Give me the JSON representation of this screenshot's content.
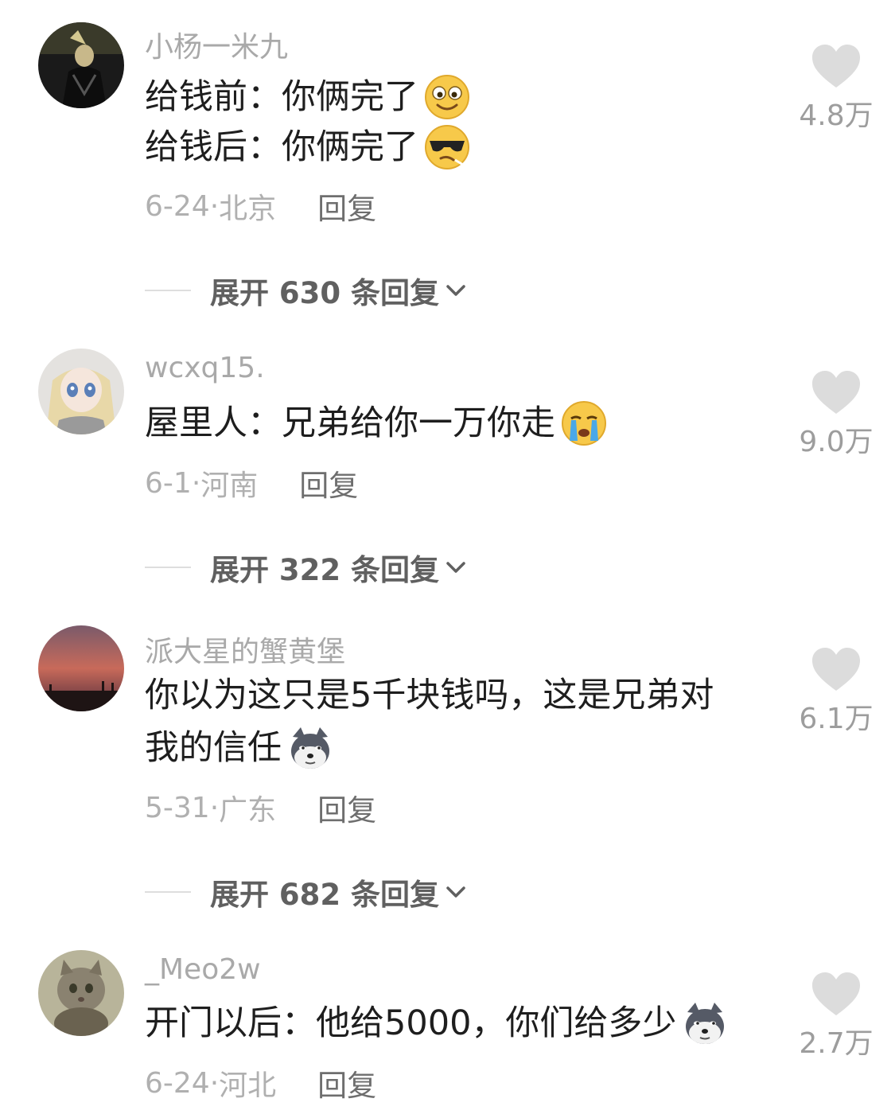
{
  "comments": [
    {
      "username": "小杨一米九",
      "lines": [
        "给钱前：你俩完了",
        "给钱后：你俩完了"
      ],
      "line_emojis": [
        "smile-emoji",
        "cool-emoji"
      ],
      "date": "6-24",
      "location": "北京",
      "reply_label": "回复",
      "likes": "4.8万",
      "expand_label": "展开 630 条回复"
    },
    {
      "username": "wcxq15.",
      "lines": [
        "屋里人：兄弟给你一万你走"
      ],
      "line_emojis": [
        "crying-emoji"
      ],
      "date": "6-1",
      "location": "河南",
      "reply_label": "回复",
      "likes": "9.0万",
      "expand_label": "展开 322 条回复"
    },
    {
      "username": "派大星的蟹黄堡",
      "lines": [
        "你以为这只是5千块钱吗，这是兄弟对",
        "我的信任"
      ],
      "line_emojis": [
        "",
        "doge-emoji"
      ],
      "date": "5-31",
      "location": "广东",
      "reply_label": "回复",
      "likes": "6.1万",
      "expand_label": "展开 682 条回复"
    },
    {
      "username": "_Meo2w",
      "lines": [
        "开门以后：他给5000，你们给多少"
      ],
      "line_emojis": [
        "doge-emoji"
      ],
      "date": "6-24",
      "location": "河北",
      "reply_label": "回复",
      "likes": "2.7万"
    }
  ],
  "meta_separator": "·",
  "colors": {
    "username": "#a9a9a9",
    "text": "#1e1e1e",
    "meta": "#b0b0b0",
    "reply": "#6e6e6e",
    "heart": "#dcdcdc",
    "expand": "#606060"
  }
}
